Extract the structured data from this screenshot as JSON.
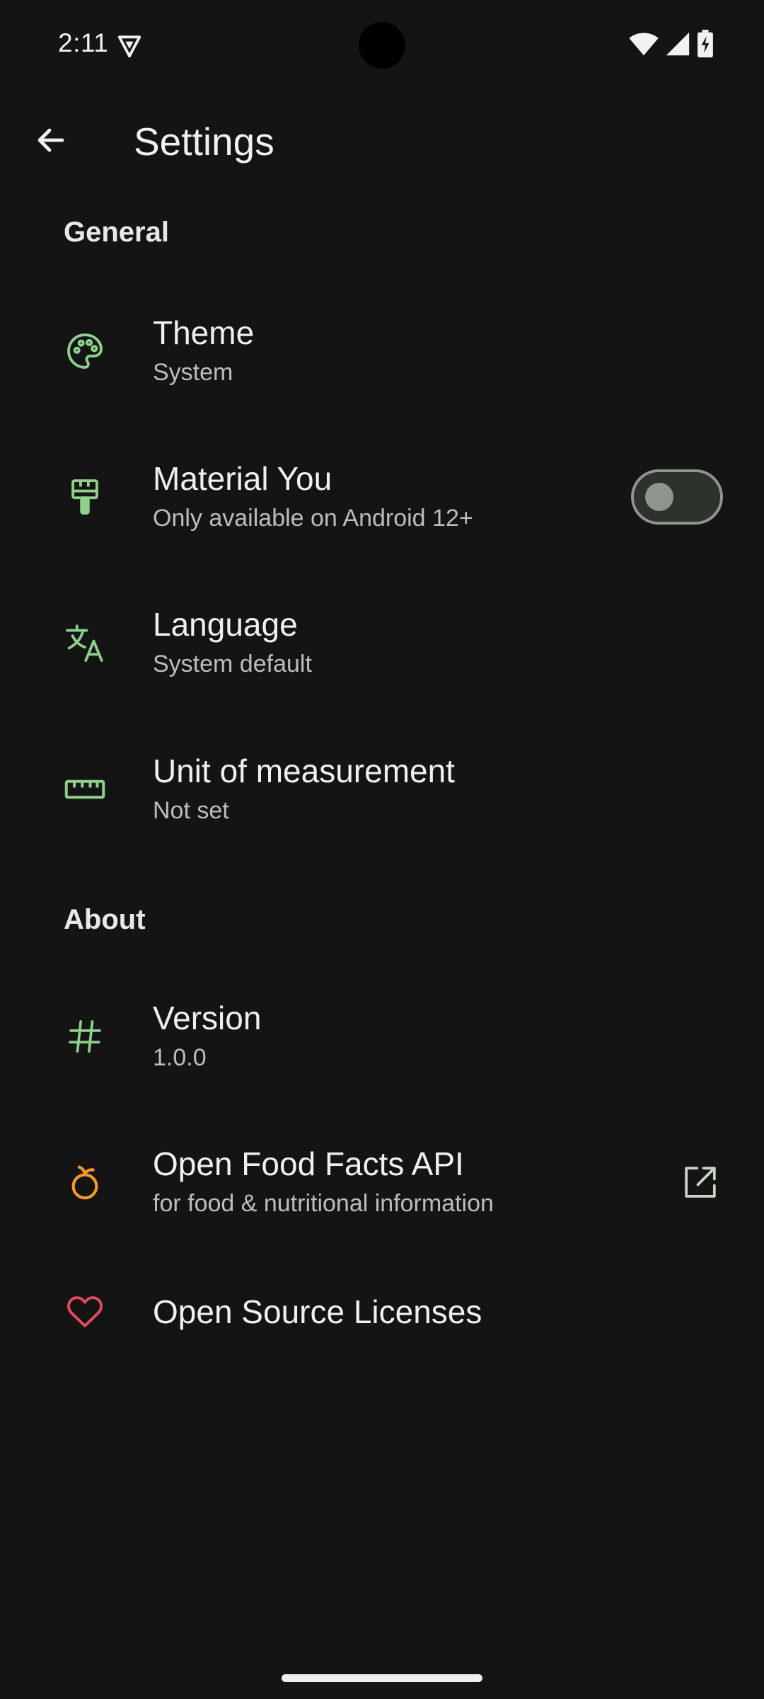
{
  "status_bar": {
    "time": "2:11",
    "icons": [
      "vpn-shield-icon",
      "wifi-icon",
      "cellular-signal-icon",
      "battery-charging-icon"
    ]
  },
  "app_bar": {
    "title": "Settings",
    "back_icon": "arrow-back-icon"
  },
  "sections": {
    "general": {
      "header": "General",
      "items": [
        {
          "title": "Theme",
          "subtitle": "System",
          "icon": "palette-icon"
        },
        {
          "title": "Material You",
          "subtitle": "Only available on Android 12+",
          "icon": "paint-brush-icon",
          "toggle_on": false
        },
        {
          "title": "Language",
          "subtitle": "System default",
          "icon": "translate-icon"
        },
        {
          "title": "Unit of measurement",
          "subtitle": "Not set",
          "icon": "ruler-icon"
        }
      ]
    },
    "about": {
      "header": "About",
      "items": [
        {
          "title": "Version",
          "subtitle": "1.0.0",
          "icon": "hashtag-icon"
        },
        {
          "title": "Open Food Facts API",
          "subtitle": "for food & nutritional information",
          "icon": "orange-fruit-icon",
          "trailing_icon": "open-external-icon"
        },
        {
          "title": "Open Source Licenses",
          "icon": "heart-icon"
        }
      ]
    }
  },
  "colors": {
    "background": "#141414",
    "accent_green": "#8fcf8c",
    "orange": "#f39a2a",
    "heart_red": "#e34a5f",
    "text_primary": "#f0f0f0",
    "text_secondary": "#bdbdbd"
  }
}
